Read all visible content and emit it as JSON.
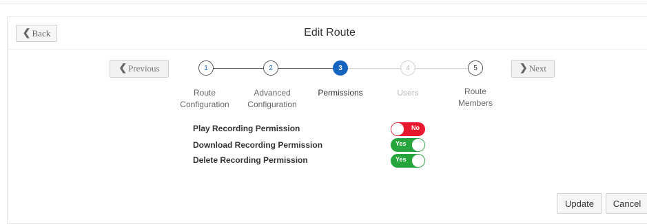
{
  "header": {
    "back_label": "Back",
    "title": "Edit Route"
  },
  "stepper": {
    "previous_label": "Previous",
    "next_label": "Next",
    "steps": [
      {
        "number": "1",
        "label_lines": [
          "Route",
          "Configuration"
        ],
        "state": "complete"
      },
      {
        "number": "2",
        "label_lines": [
          "Advanced",
          "Configuration"
        ],
        "state": "complete"
      },
      {
        "number": "3",
        "label_lines": [
          "Permissions"
        ],
        "state": "active"
      },
      {
        "number": "4",
        "label_lines": [
          "Users"
        ],
        "state": "disabled"
      },
      {
        "number": "5",
        "label_lines": [
          "Route",
          "Members"
        ],
        "state": "complete"
      }
    ]
  },
  "permissions": [
    {
      "label": "Play Recording Permission",
      "toggle_text": "No",
      "on": false
    },
    {
      "label": "Download Recording Permission",
      "toggle_text": "Yes",
      "on": true
    },
    {
      "label": "Delete Recording Permission",
      "toggle_text": "Yes",
      "on": true
    }
  ],
  "actions": {
    "update_label": "Update",
    "cancel_label": "Cancel"
  },
  "colors": {
    "active_step": "#1565c0",
    "toggle_on": "#25a53c",
    "toggle_off": "#e8192c"
  }
}
